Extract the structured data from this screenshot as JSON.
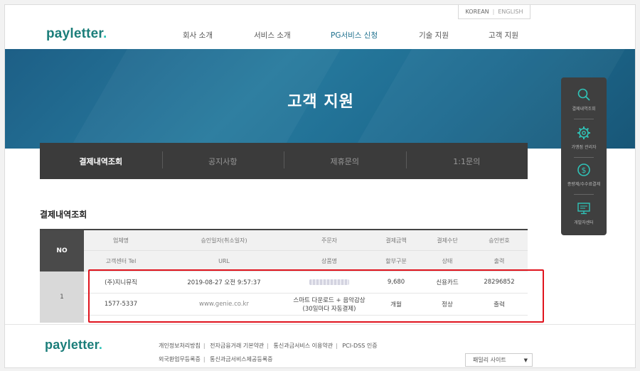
{
  "lang": {
    "korean": "KOREAN",
    "english": "ENGLISH"
  },
  "header": {
    "logo_main": "payletter",
    "logo_dot": ".",
    "nav": [
      "회사 소개",
      "서비스 소개",
      "PG서비스 신청",
      "기술 지원",
      "고객 지원"
    ]
  },
  "hero": {
    "title": "고객 지원"
  },
  "tabs": [
    "결제내역조회",
    "공지사항",
    "제휴문의",
    "1:1문의"
  ],
  "section": {
    "title": "결제내역조회"
  },
  "table": {
    "no_header": "NO",
    "header_row1": [
      "업체명",
      "승인일자(취소일자)",
      "주문자",
      "결제금액",
      "결제수단",
      "승인번호"
    ],
    "header_row2": [
      "고객센터 Tel",
      "URL",
      "상품명",
      "할부구분",
      "상태",
      "출력"
    ],
    "row_no": "1",
    "row1": {
      "company": "(주)지니뮤직",
      "date": "2019-08-27 오전 9:57:37",
      "amount": "9,680",
      "method": "신용카드",
      "approval": "28296852"
    },
    "row2": {
      "tel": "1577-5337",
      "url": "www.genie.co.kr",
      "product": "스마트 다운로드 + 음악감상 (30일마다 자동결제)",
      "installment": "개월",
      "status": "정상",
      "print": "출력"
    }
  },
  "quick_menu": {
    "items": [
      "결제내역조회",
      "가맹점 관리자",
      "종량제/수수료결제",
      "개발자센터"
    ]
  },
  "footer": {
    "logo_main": "payletter",
    "logo_dot": ".",
    "links_row1": [
      "개인정보처리방침",
      "전자금융거래 기본약관",
      "통신과금서비스 이용약관",
      "PCI-DSS 인증"
    ],
    "links_row2": [
      "외국환업무등록증",
      "통신과금서비스제공등록증"
    ],
    "family_site": "패밀리 사이트"
  },
  "colors": {
    "brand": "#1b7e7a",
    "brand_accent": "#2fc4b8",
    "hero": "#1d6a8f",
    "highlight": "#e0141e",
    "tab_bg": "#3b3b3b"
  }
}
